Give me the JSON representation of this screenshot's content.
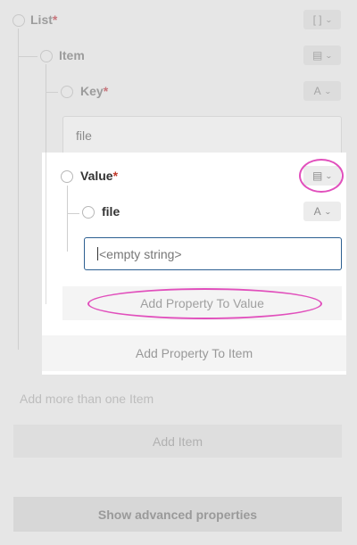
{
  "tree": {
    "list": {
      "label": "List",
      "required_marker": "*",
      "type_glyph": "[ ]",
      "type_chevron": "⌄"
    },
    "item": {
      "label": "Item",
      "type_glyph": "▤",
      "type_chevron": "⌄"
    },
    "key": {
      "label": "Key",
      "required_marker": "*",
      "type_glyph": "A",
      "type_chevron": "⌄",
      "value": "file"
    },
    "value": {
      "label": "Value",
      "required_marker": "*",
      "type_glyph": "▤",
      "type_chevron": "⌄"
    },
    "file": {
      "label": "file",
      "type_glyph": "A",
      "type_chevron": "⌄",
      "placeholder": "<empty string>"
    }
  },
  "buttons": {
    "add_property_to_value": "Add Property To Value",
    "add_property_to_item": "Add Property To Item",
    "add_more_than_one_item": "Add more than one Item",
    "add_item": "Add Item",
    "show_advanced_properties": "Show advanced properties"
  },
  "colors": {
    "highlight": "#e14fbc",
    "input_focus_border": "#2c5f91",
    "required": "#c0392b"
  }
}
